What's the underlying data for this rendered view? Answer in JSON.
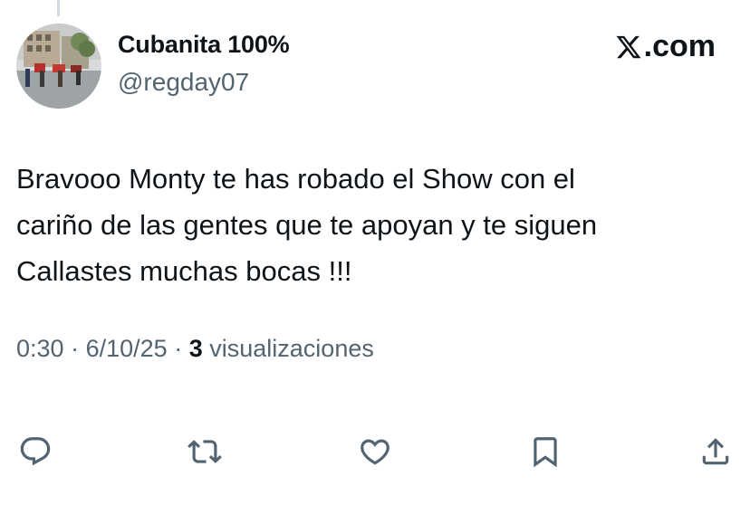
{
  "user": {
    "display_name": "Cubanita 100%",
    "handle": "@regday07",
    "avatar": "street-scene-photo"
  },
  "brand": {
    "label": ".com",
    "icon": "x-logo-icon"
  },
  "tweet": {
    "text": "Bravooo Monty  te has robado el Show con el\ncariño de las gentes que te apoyan y te siguen\nCallastes muchas bocas !!!"
  },
  "meta": {
    "time": "0:30",
    "separator": "·",
    "date": "6/10/25",
    "views_count": "3",
    "views_label": "visualizaciones"
  },
  "actions": [
    {
      "name": "reply",
      "icon": "reply-icon"
    },
    {
      "name": "retweet",
      "icon": "retweet-icon"
    },
    {
      "name": "like",
      "icon": "heart-icon"
    },
    {
      "name": "bookmark",
      "icon": "bookmark-icon"
    },
    {
      "name": "share",
      "icon": "share-icon"
    }
  ],
  "colors": {
    "text": "#0f1419",
    "secondary": "#536471",
    "thread_line": "#cfd9de"
  }
}
